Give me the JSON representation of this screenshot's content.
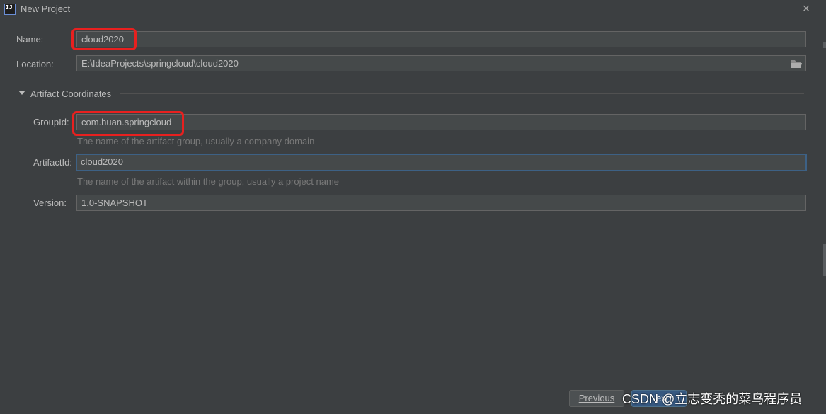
{
  "window": {
    "title": "New Project",
    "app_icon_text": "IJ",
    "close_symbol": "×"
  },
  "form": {
    "name": {
      "label": "Name:",
      "value": "cloud2020"
    },
    "location": {
      "label": "Location:",
      "value": "E:\\IdeaProjects\\springcloud\\cloud2020",
      "button_icon": "folder-icon"
    },
    "artifact_section": {
      "title": "Artifact Coordinates",
      "expanded": true
    },
    "group_id": {
      "label": "GroupId:",
      "value": "com.huan.springcloud",
      "hint": "The name of the artifact group, usually a company domain"
    },
    "artifact_id": {
      "label": "ArtifactId:",
      "value": "cloud2020",
      "hint": "The name of the artifact within the group, usually a project name"
    },
    "version": {
      "label": "Version:",
      "value": "1.0-SNAPSHOT"
    }
  },
  "buttons": {
    "previous": "Previous",
    "next": "Next"
  },
  "watermark": "CSDN @立志变秃的菜鸟程序员",
  "colors": {
    "background": "#3c3f41",
    "field_background": "#45494a",
    "focus_border": "#3d6185",
    "highlight": "#e8201f",
    "primary_button": "#365880"
  }
}
